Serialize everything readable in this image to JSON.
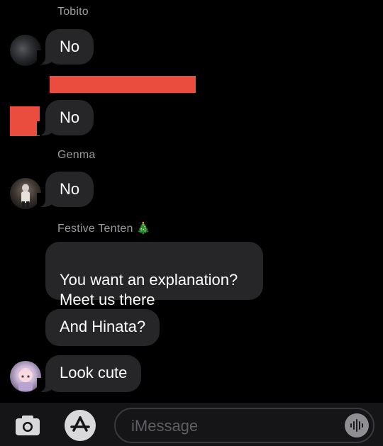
{
  "conversation": {
    "messages": [
      {
        "sender": "Tobito",
        "text": "No"
      },
      {
        "sender": "",
        "text": "No"
      },
      {
        "sender": "Genma",
        "text": "No"
      },
      {
        "sender": "Festive Tenten 🎄",
        "text": "You want an explanation?\nMeet us there"
      },
      {
        "sender": "",
        "text": "And Hinata?"
      },
      {
        "sender": "",
        "text": "Look cute"
      }
    ]
  },
  "composer": {
    "placeholder": "iMessage",
    "camera_icon": "camera-icon",
    "apps_icon": "app-store-icon",
    "voice_icon": "voice-memo-icon"
  },
  "colors": {
    "background": "#000000",
    "bubble": "#262629",
    "sender_name": "#9a9a9f",
    "redaction": "#ea4d3d"
  }
}
